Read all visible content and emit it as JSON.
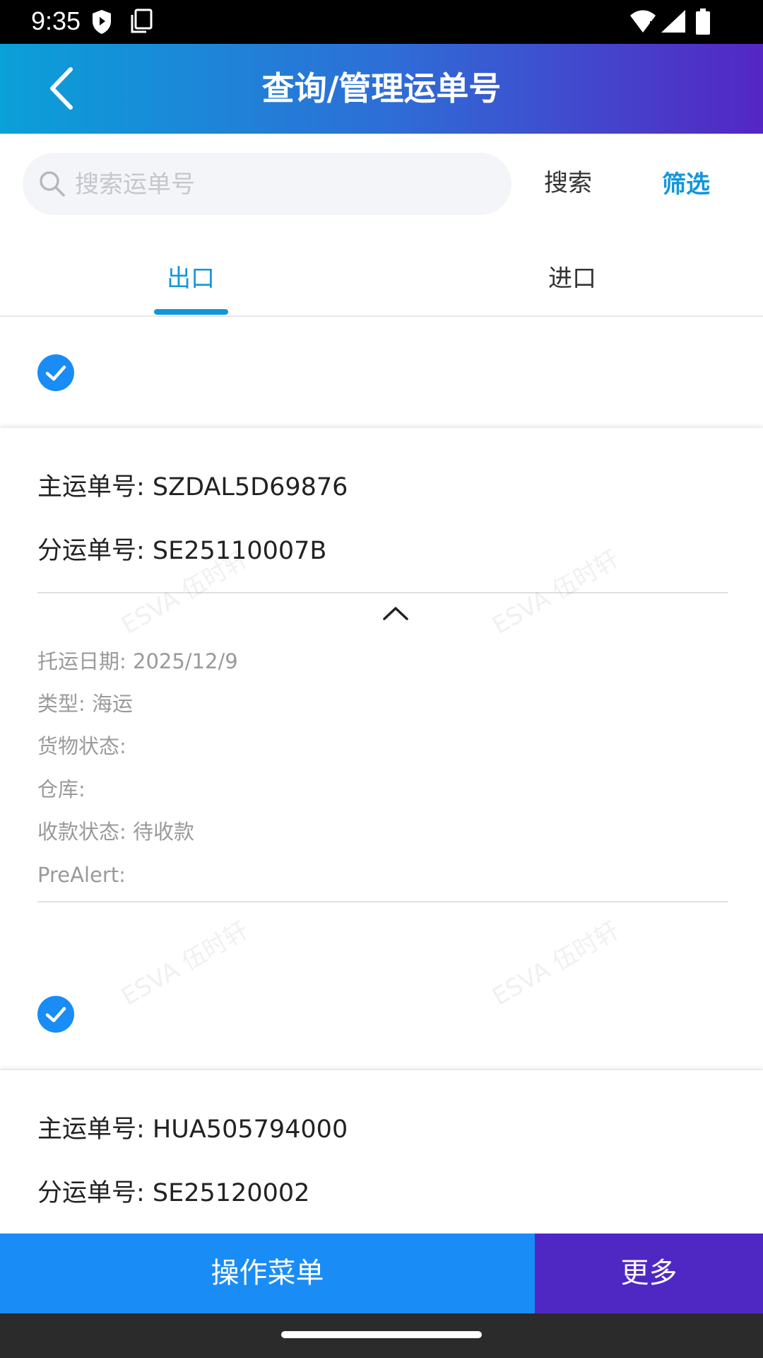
{
  "status_bar": {
    "time": "9:35"
  },
  "header": {
    "title": "查询/管理运单号"
  },
  "search": {
    "placeholder": "搜索运单号",
    "value": "",
    "search_label": "搜索",
    "filter_label": "筛选"
  },
  "tabs": [
    {
      "label": "出口",
      "active": true
    },
    {
      "label": "进口",
      "active": false
    }
  ],
  "colors": {
    "accent": "#1296db",
    "brand_blue": "#1a8cf5",
    "brand_purple": "#4f28c3"
  },
  "watermark": "ESVA 伍时轩",
  "waybills": [
    {
      "selected": true,
      "main_no": "主运单号: SZDAL5D69876",
      "sub_no": "分运单号: SE25110007B",
      "expanded": true,
      "details": [
        "托运日期: 2025/12/9",
        "类型: 海运",
        "货物状态:",
        "仓库:",
        "收款状态: 待收款",
        "PreAlert:"
      ]
    },
    {
      "selected": true,
      "main_no": "主运单号: HUA505794000",
      "sub_no": "分运单号: SE25120002"
    }
  ],
  "bottom_actions": {
    "menu_label": "操作菜单",
    "more_label": "更多"
  }
}
